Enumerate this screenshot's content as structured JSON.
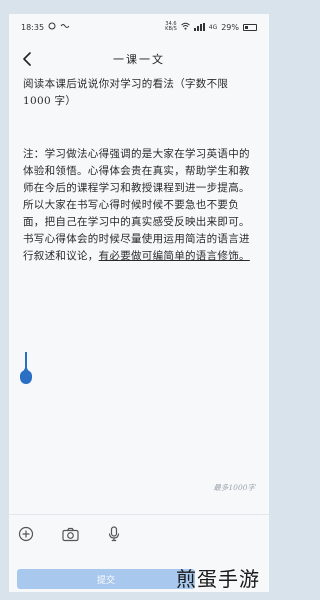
{
  "status_bar": {
    "time": "18:35",
    "net_speed": "34.6\nKB/S",
    "network": "4G",
    "battery": "29%"
  },
  "nav": {
    "title": "一课一文"
  },
  "content": {
    "intro": "阅读本课后说说你对学习的看法（字数不限 1000 字）",
    "note_main": "注：学习做法心得强调的是大家在学习英语中的体验和领悟。心得体会贵在真实，帮助学生和教师在今后的课程学习和教授课程到进一步提高。所以大家在书写心得时候时候不要急也不要负面，把自己在学习中的真实感受反映出来即可。书写心得体会的时候尽量使用运用简洁的语言进行叙述和议论，",
    "note_underlined": "有必要做可编简单的语言修饰。"
  },
  "editor": {
    "counter": "最多1000字"
  },
  "toolbar": {
    "add_icon": "plus-circle-icon",
    "camera_icon": "camera-icon",
    "mic_icon": "microphone-icon"
  },
  "footer": {
    "submit_label": "提交"
  },
  "watermark": "煎蛋手游",
  "colors": {
    "accent": "#2b6fc4",
    "button_disabled": "#a9c8ee",
    "frame_bg": "#d9e3ec"
  }
}
